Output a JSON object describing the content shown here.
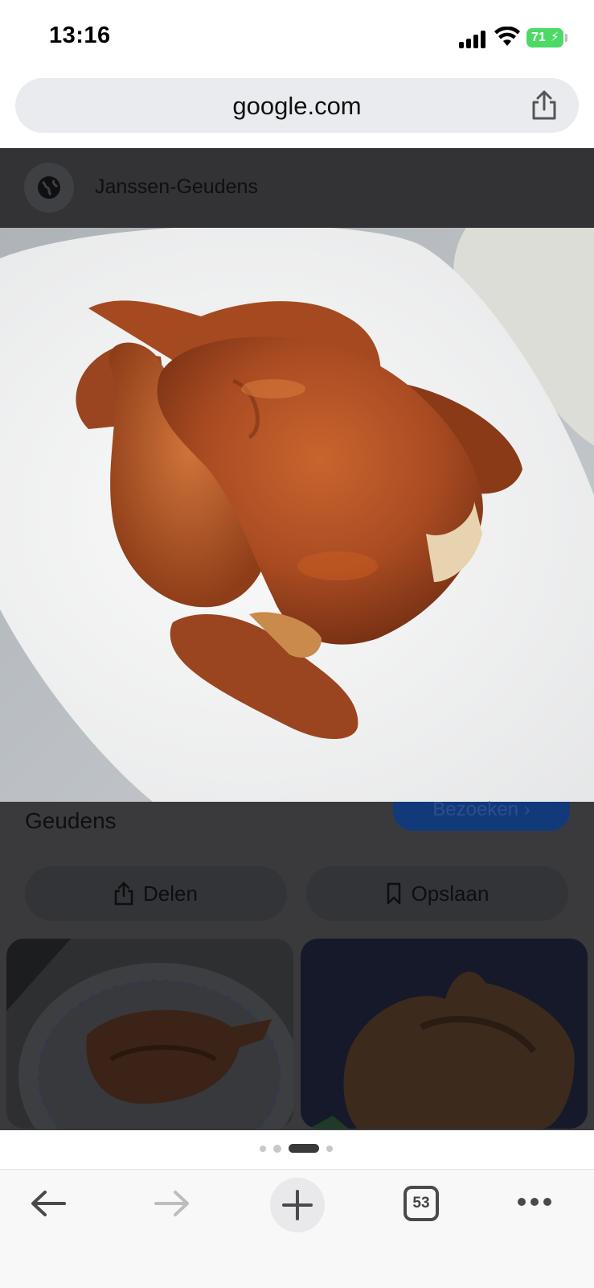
{
  "status_bar": {
    "time": "13:16",
    "battery": "71"
  },
  "address_bar": {
    "url": "google.com"
  },
  "source": {
    "name": "Janssen-Geudens"
  },
  "result": {
    "title_line": "Geudens",
    "visit_label": "Bezoeken"
  },
  "actions": {
    "share_label": "Delen",
    "save_label": "Opslaan"
  },
  "toolbar": {
    "tab_count": "53"
  },
  "colors": {
    "accent_blue": "#123a7a",
    "battery_green": "#4cd964",
    "overlay_dark": "#3a3a3d"
  },
  "icons": {
    "share": "share-icon",
    "globe": "globe-icon",
    "bookmark": "bookmark-icon",
    "back": "back-arrow-icon",
    "forward": "forward-arrow-icon",
    "new_tab": "plus-icon",
    "more": "more-icon"
  }
}
